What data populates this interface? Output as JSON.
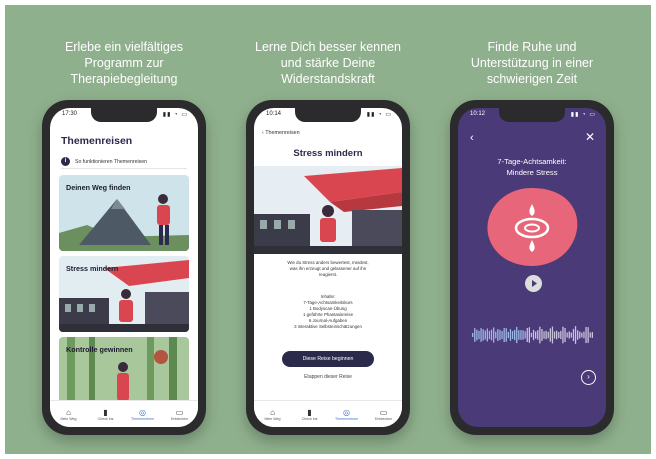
{
  "captions": [
    [
      "Erlebe ein vielfältiges",
      "Programm zur",
      "Therapiebegleitung"
    ],
    [
      "Lerne Dich besser kennen",
      "und stärke Deine",
      "Widerstandskraft"
    ],
    [
      "Finde Ruhe und",
      "Unterstützung in einer",
      "schwierigen Zeit"
    ]
  ],
  "screen1": {
    "time": "17:30",
    "title": "Themenreisen",
    "info": "So funktionieren Themenreisen",
    "cards": [
      "Deinen Weg finden",
      "Stress mindern",
      "Kontrolle gewinnen"
    ],
    "tabs": [
      "Mein Weg",
      "Check ins",
      "Themenreisen",
      "Entdecken"
    ]
  },
  "screen2": {
    "time": "10:14",
    "back": "Themenreisen",
    "title": "Stress mindern",
    "desc": [
      "Wie du Stress anders bewertest, meidest,",
      "was ihn erzeugt und gelassener auf ihn",
      "reagierst."
    ],
    "inhalte_label": "Inhalte:",
    "inhalte": [
      "7-Tage-Achtsamkeitskurs",
      "1 Bodyscan-Übung",
      "1 geführte Phantasiereise",
      "6 Journal-Aufgaben",
      "3 interaktive Selbsteinschätzungen"
    ],
    "button": "Diese Reise beginnen",
    "stages": "Etappen dieser Reise",
    "tabs": [
      "Mein Weg",
      "Check ins",
      "Themenreisen",
      "Entdecken"
    ]
  },
  "screen3": {
    "time": "10:12",
    "title": [
      "7-Tage-Achtsamkeit:",
      "Mindere Stress"
    ]
  },
  "colors": {
    "background": "#8fb08d",
    "navy": "#2c2a4a",
    "purple": "#4a3a78",
    "coral": "#e8667a",
    "tab_active": "#3a6fc4"
  }
}
